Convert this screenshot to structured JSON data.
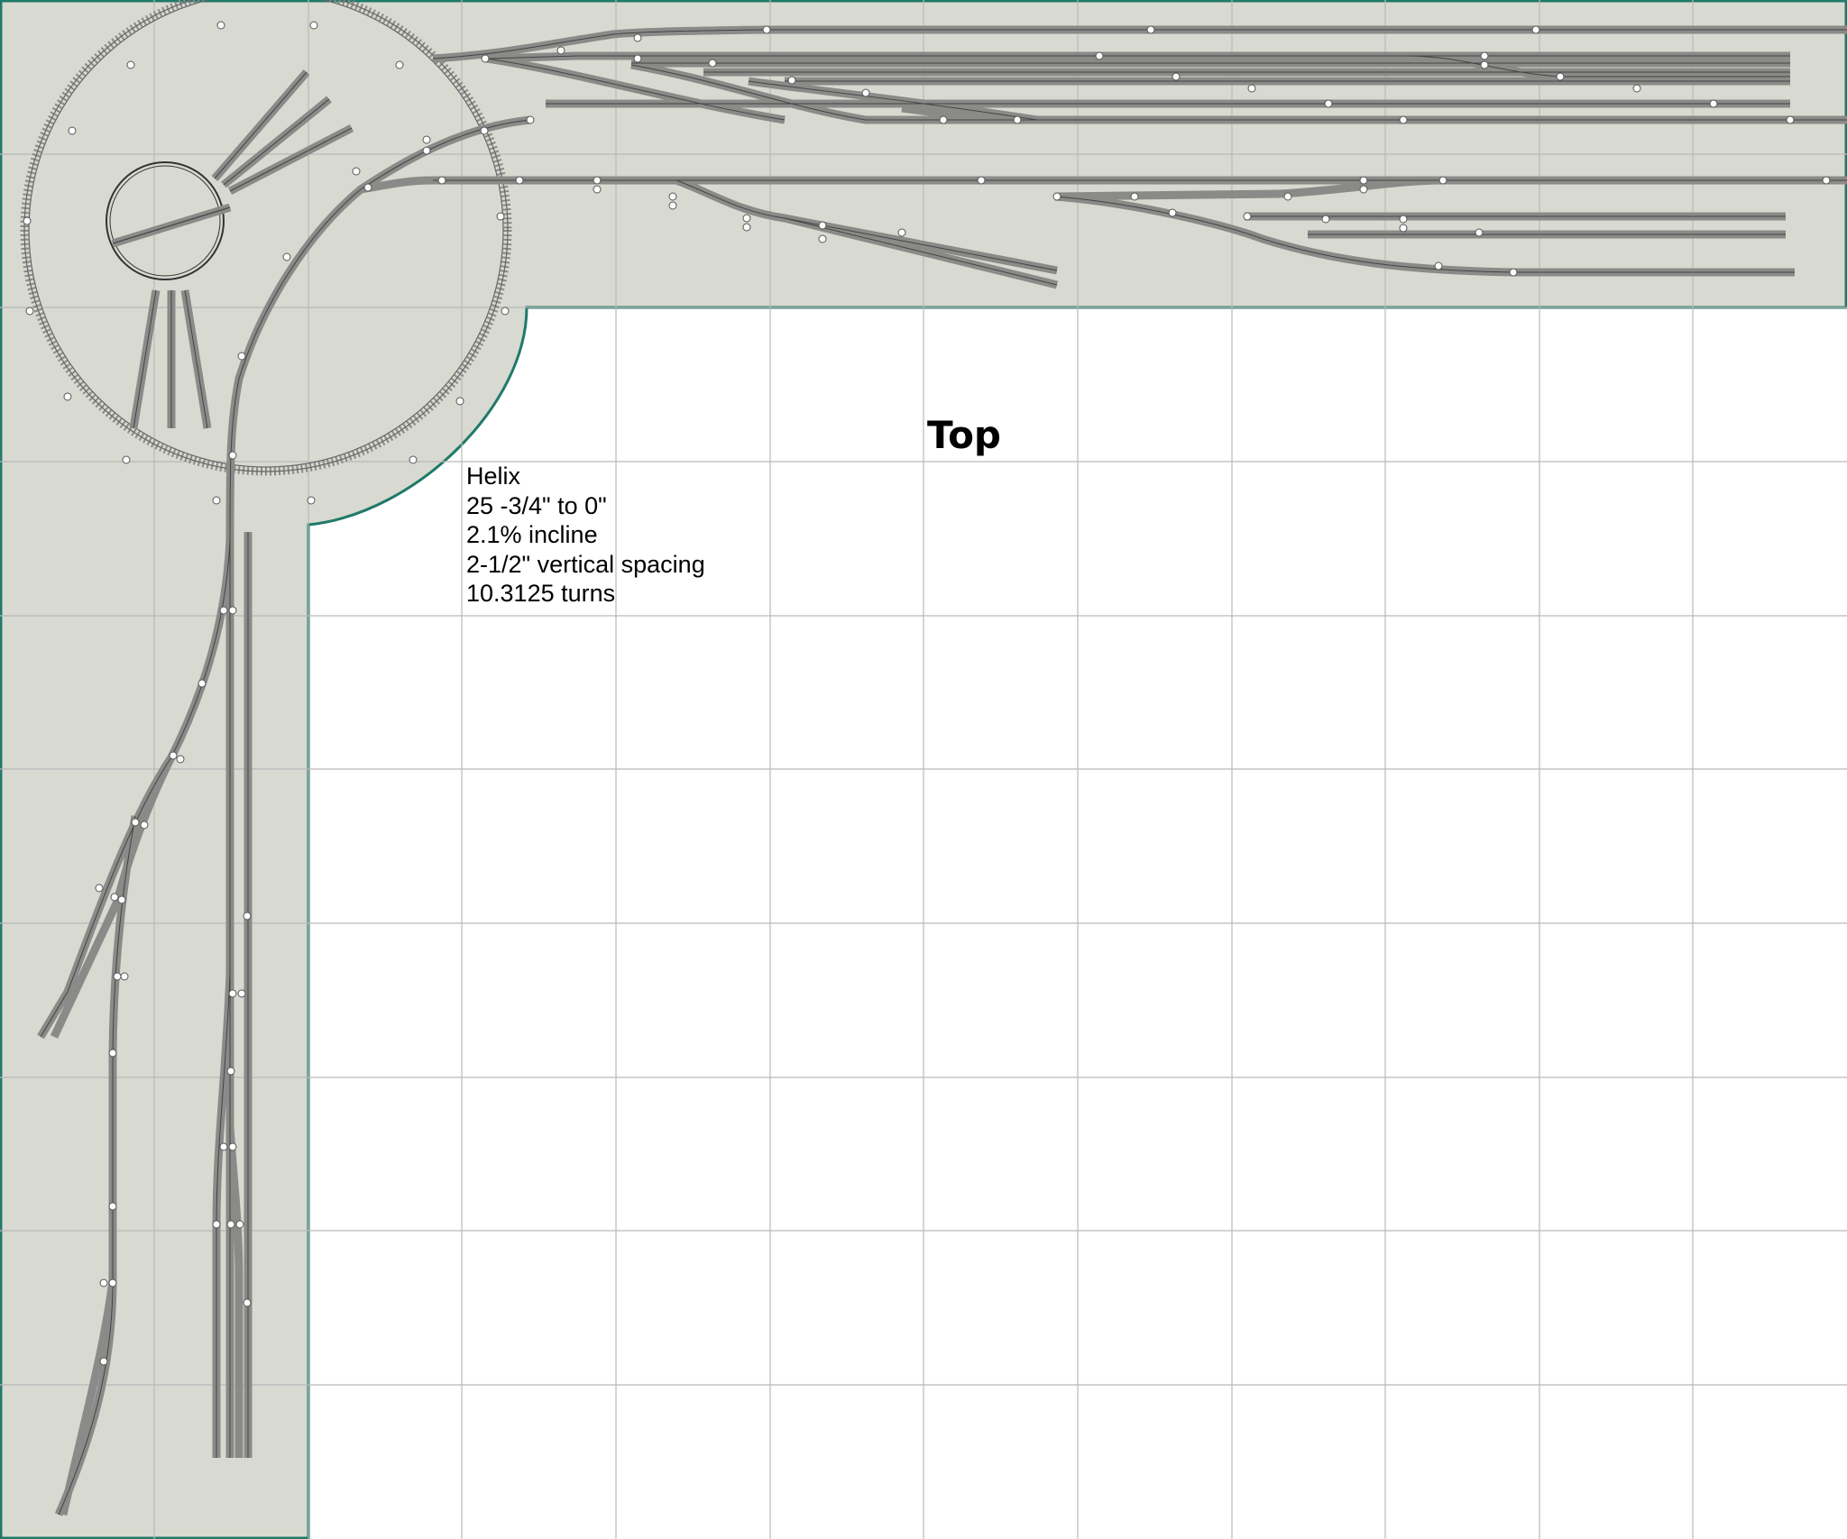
{
  "diagram": {
    "title": "Top",
    "colors": {
      "benchwork_fill": "#d8d9d0",
      "benchwork_edge": "#1f7a6a",
      "grid": "#b9b9b9",
      "rail": "#333333",
      "tie": "#8a8a88",
      "joint": "#ffffff"
    },
    "helix_note": {
      "name": "Helix",
      "rise": "25 -3/4\" to 0\"",
      "grade": "2.1% incline",
      "spacing": "2-1/2\" vertical spacing",
      "turns": "10.3125 turns"
    },
    "elements": {
      "benchwork": "L-shaped benchwork",
      "helix": "helix loop",
      "turntable": "turntable",
      "upper_yard": "upper yard tracks",
      "lower_yard": "lower yard tracks",
      "left_spur": "left staging tracks"
    }
  }
}
